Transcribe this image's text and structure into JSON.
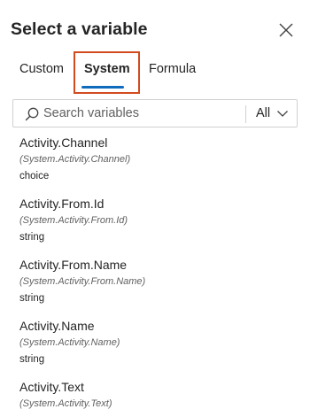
{
  "panel": {
    "title": "Select a variable",
    "close_icon": "close-icon"
  },
  "tabs": [
    {
      "label": "Custom",
      "selected": false
    },
    {
      "label": "System",
      "selected": true
    },
    {
      "label": "Formula",
      "selected": false
    }
  ],
  "highlight_color": "#d24b1e",
  "accent_color": "#0f6cbd",
  "search": {
    "placeholder": "Search variables",
    "value": "",
    "icon": "search-icon"
  },
  "filter": {
    "selected": "All",
    "icon": "chevron-down-icon"
  },
  "variables": [
    {
      "name": "Activity.Channel",
      "path": "(System.Activity.Channel)",
      "type": "choice"
    },
    {
      "name": "Activity.From.Id",
      "path": "(System.Activity.From.Id)",
      "type": "string"
    },
    {
      "name": "Activity.From.Name",
      "path": "(System.Activity.From.Name)",
      "type": "string"
    },
    {
      "name": "Activity.Name",
      "path": "(System.Activity.Name)",
      "type": "string"
    },
    {
      "name": "Activity.Text",
      "path": "(System.Activity.Text)",
      "type": ""
    }
  ]
}
